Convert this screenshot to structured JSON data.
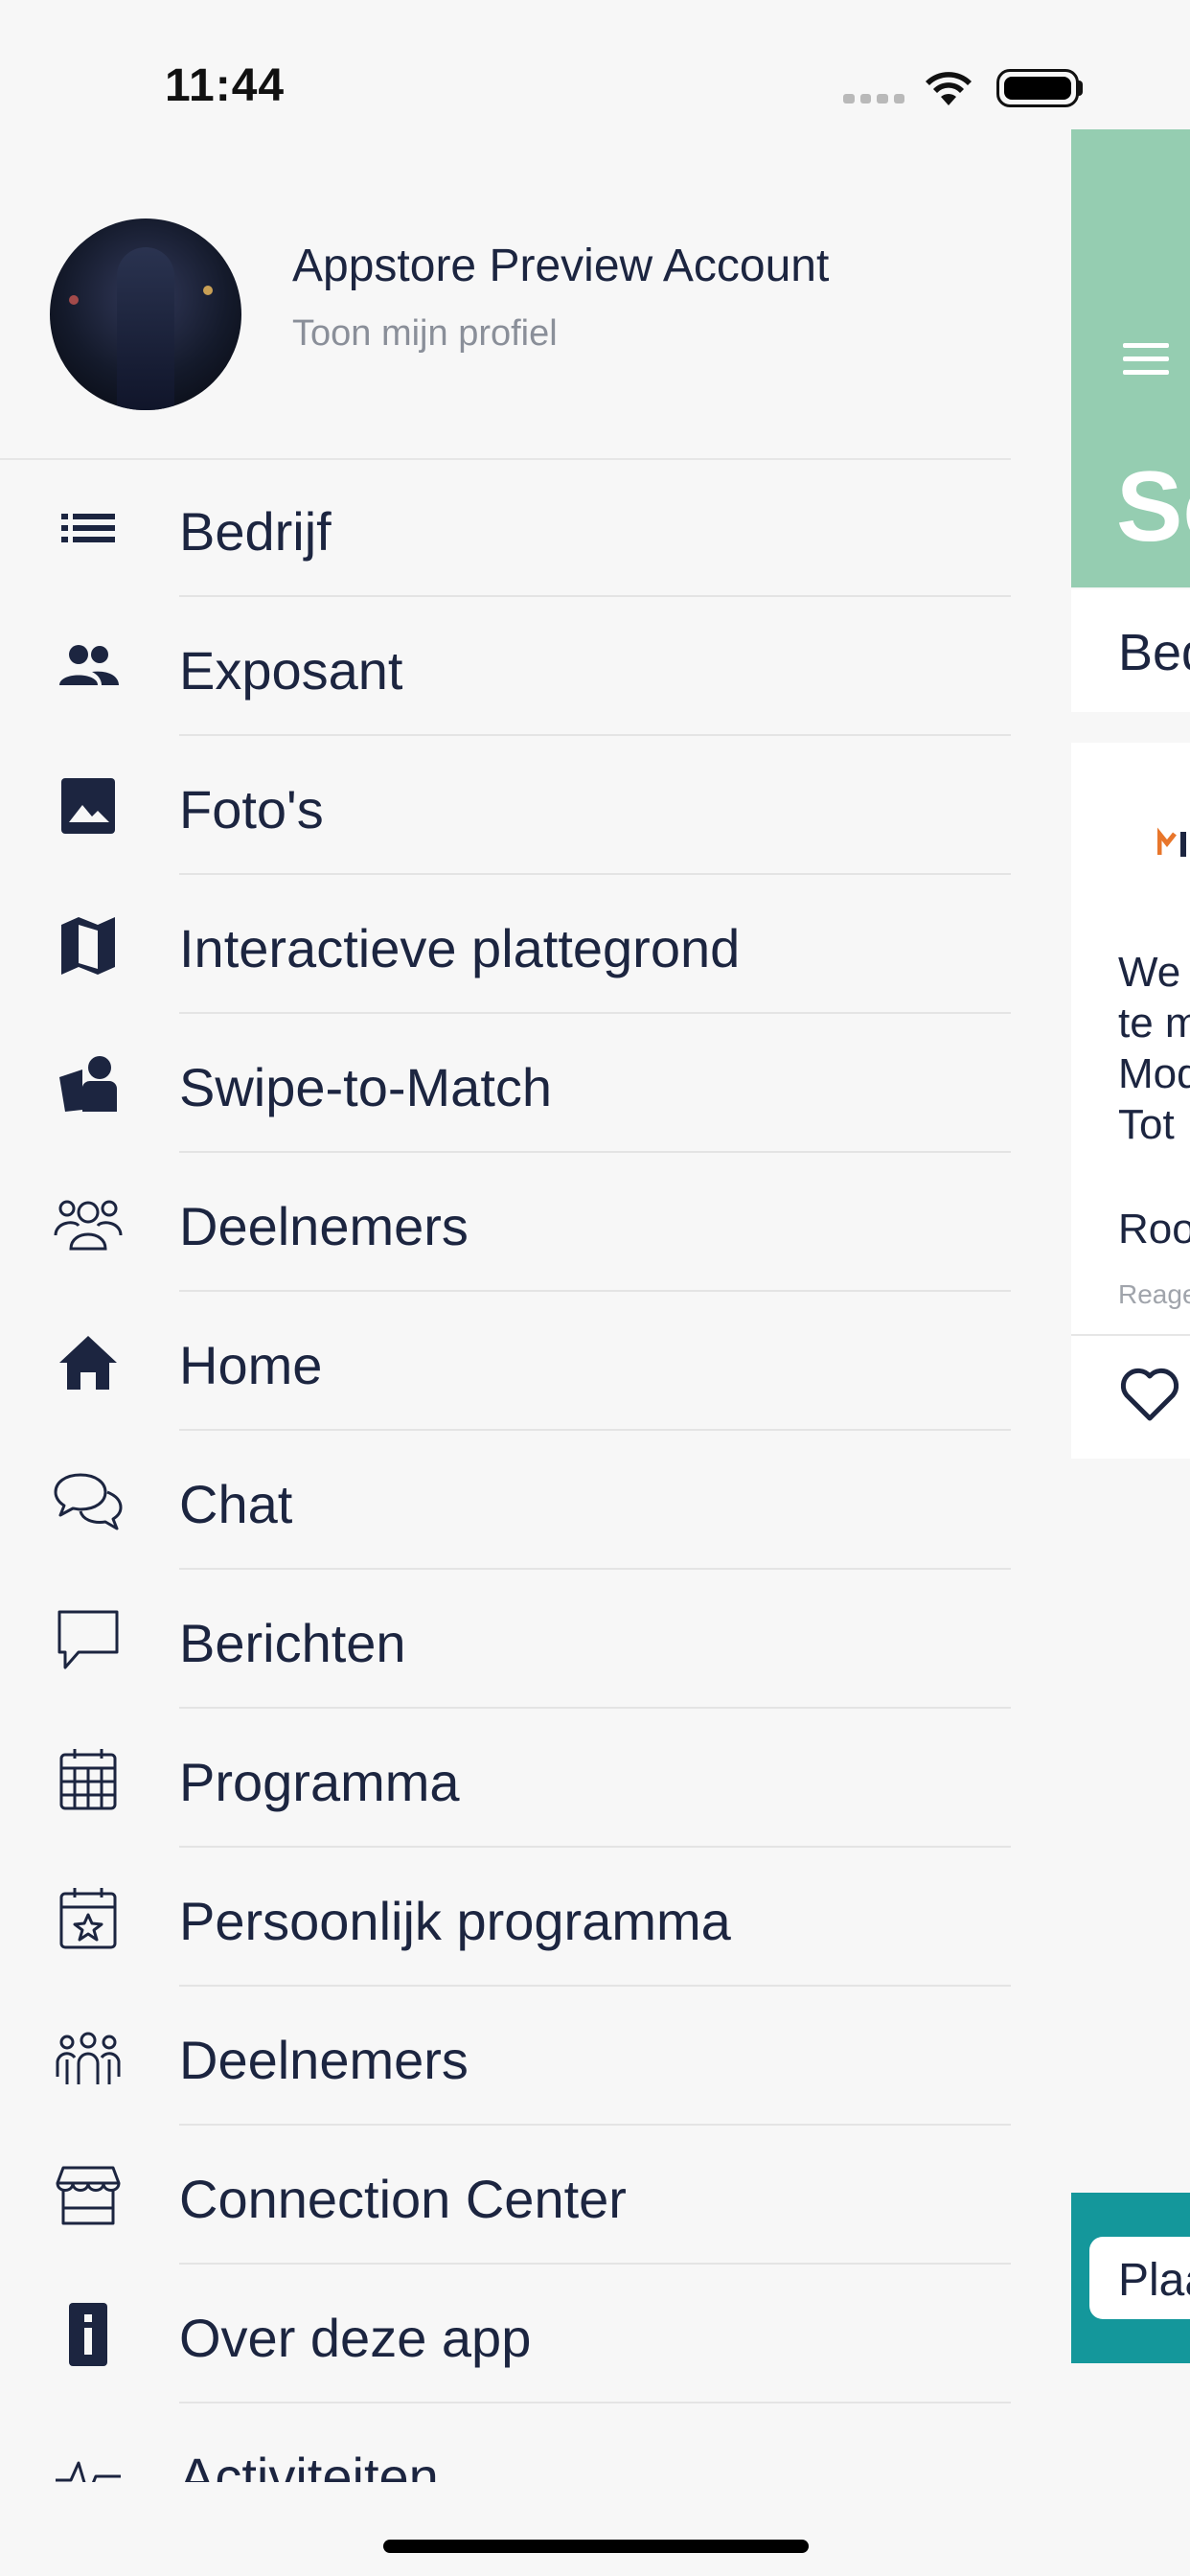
{
  "status_bar": {
    "time": "11:44"
  },
  "profile": {
    "name": "Appstore Preview Account",
    "link": "Toon mijn profiel"
  },
  "menu": {
    "items": [
      {
        "label": "Bedrijf",
        "icon": "list-icon"
      },
      {
        "label": "Exposant",
        "icon": "people-icon"
      },
      {
        "label": "Foto's",
        "icon": "image-icon"
      },
      {
        "label": "Interactieve plattegrond",
        "icon": "map-icon"
      },
      {
        "label": "Swipe-to-Match",
        "icon": "swipe-match-icon"
      },
      {
        "label": "Deelnemers",
        "icon": "group-icon"
      },
      {
        "label": "Home",
        "icon": "home-icon"
      },
      {
        "label": "Chat",
        "icon": "chat-bubbles-icon"
      },
      {
        "label": "Berichten",
        "icon": "message-icon"
      },
      {
        "label": "Programma",
        "icon": "calendar-icon"
      },
      {
        "label": "Persoonlijk programma",
        "icon": "calendar-star-icon"
      },
      {
        "label": "Deelnemers",
        "icon": "attendees-icon"
      },
      {
        "label": "Connection Center",
        "icon": "store-icon"
      },
      {
        "label": "Over deze app",
        "icon": "info-icon"
      },
      {
        "label": "Activiteiten",
        "icon": "activity-icon"
      }
    ]
  },
  "background_app": {
    "title_fragment": "Sc",
    "subbar_fragment": "Bed",
    "card_lines": [
      "We",
      "te m",
      "Mod",
      "Tot"
    ],
    "author_fragment": "Roo",
    "meta_fragment": "Reage",
    "footer_button_fragment": "Plaa",
    "header_color": "#95cdb1",
    "footer_color": "#14979b"
  }
}
